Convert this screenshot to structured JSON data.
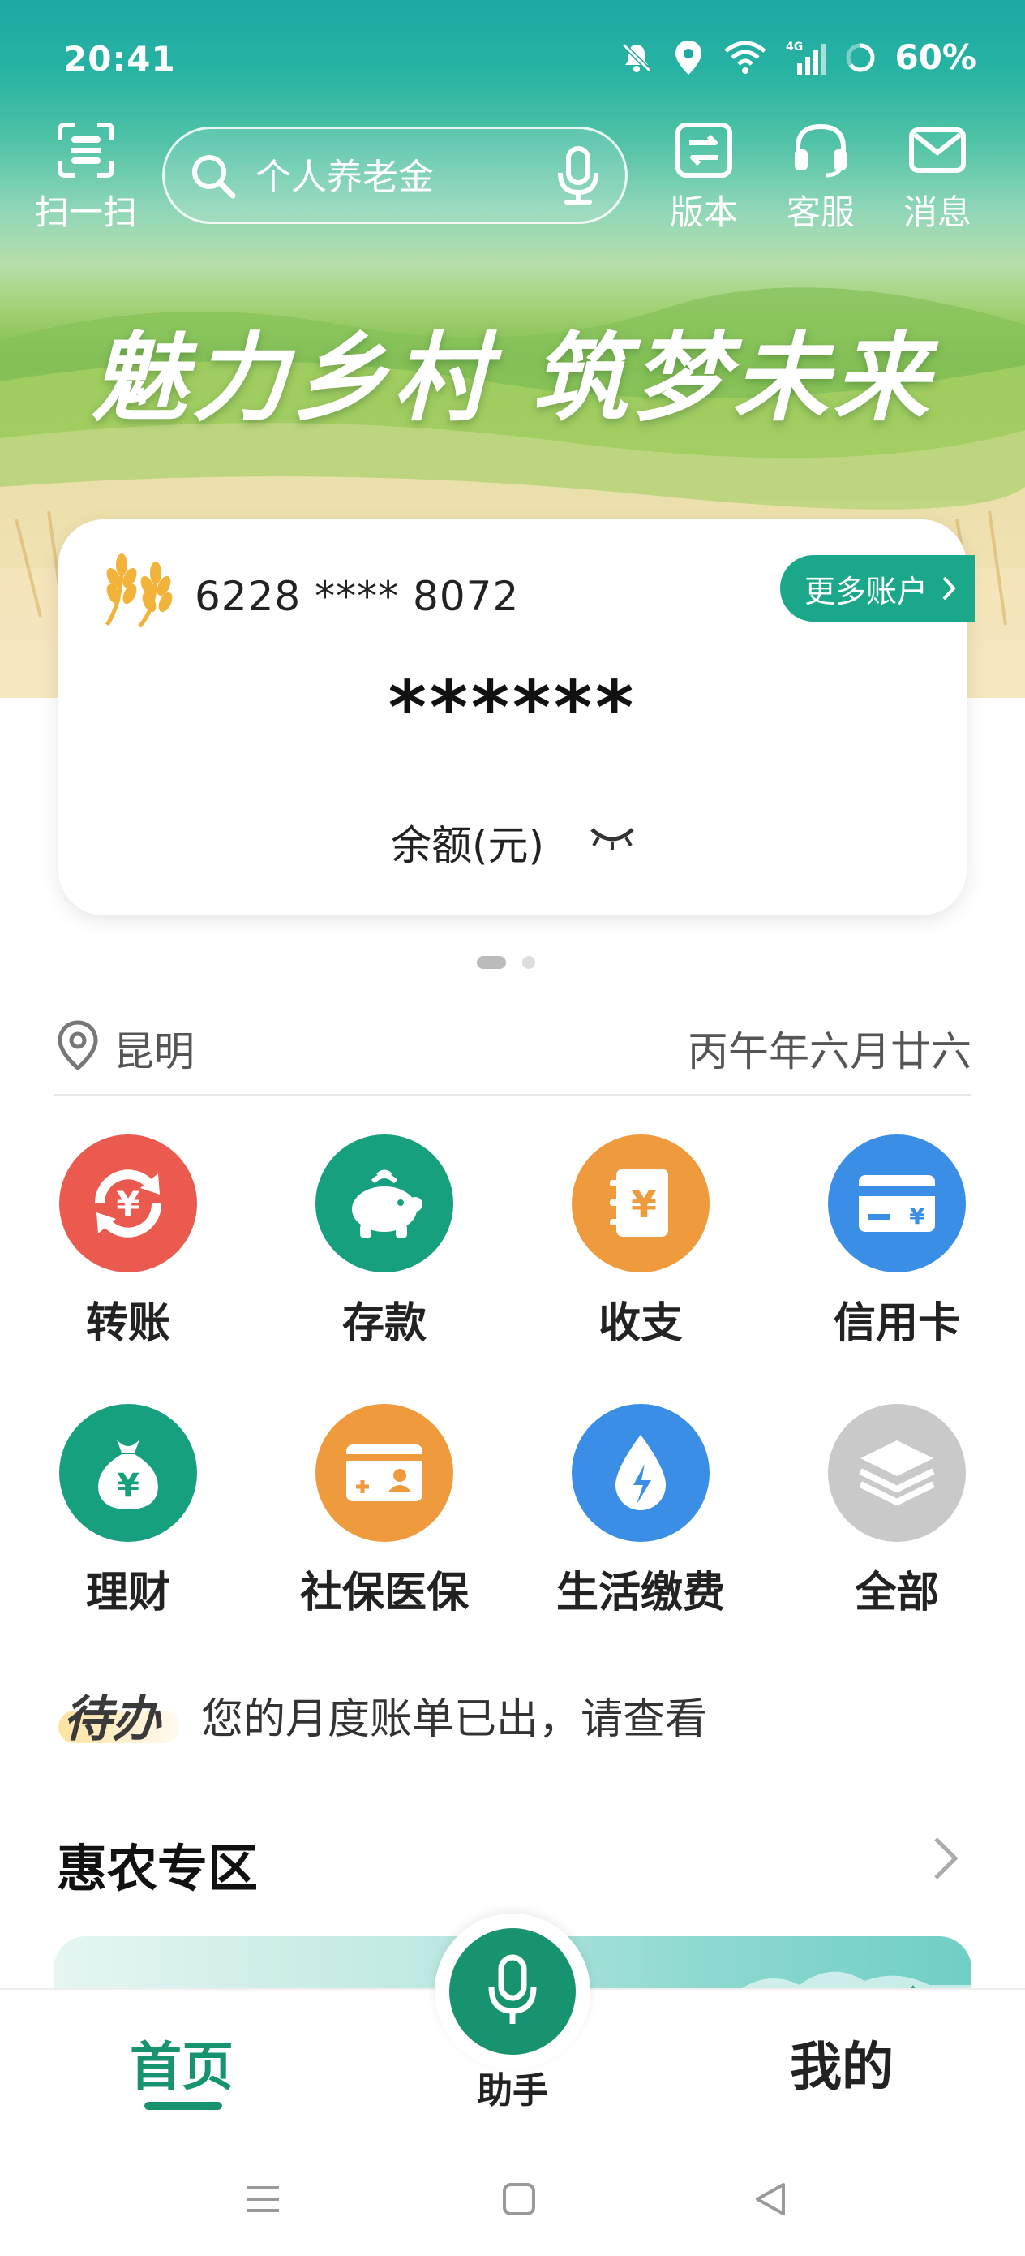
{
  "status_bar": {
    "time": "20:41",
    "network": "4G",
    "battery": "60%"
  },
  "topbar": {
    "scan_label": "扫一扫",
    "search_placeholder": "个人养老金",
    "version_label": "版本",
    "service_label": "客服",
    "messages_label": "消息"
  },
  "banner": {
    "slogan": "魅力乡村 筑梦未来"
  },
  "account": {
    "card_number": "6228 **** 8072",
    "more_accounts": "更多账户",
    "balance_masked": "******",
    "balance_label": "余额(元)"
  },
  "location": {
    "city": "昆明",
    "lunar_date": "丙午年六月廿六"
  },
  "functions": [
    {
      "label": "转账",
      "color": "#ea5a4f",
      "icon": "transfer-icon"
    },
    {
      "label": "存款",
      "color": "#17a07e",
      "icon": "piggy-bank-icon"
    },
    {
      "label": "收支",
      "color": "#ef9a3c",
      "icon": "ledger-icon"
    },
    {
      "label": "信用卡",
      "color": "#3a8ee6",
      "icon": "credit-card-icon"
    },
    {
      "label": "理财",
      "color": "#17a07e",
      "icon": "money-bag-icon"
    },
    {
      "label": "社保医保",
      "color": "#ef9a3c",
      "icon": "id-card-icon"
    },
    {
      "label": "生活缴费",
      "color": "#3a8ee6",
      "icon": "utility-drop-icon"
    },
    {
      "label": "全部",
      "color": "#c9c9c9",
      "icon": "layers-icon"
    }
  ],
  "todo": {
    "tag": "待办",
    "text": "您的月度账单已出，请查看"
  },
  "section": {
    "title": "惠农专区"
  },
  "bottom_nav": {
    "home": "首页",
    "assistant": "助手",
    "mine": "我的"
  },
  "colors": {
    "brand_green": "#17946f",
    "teal_top": "#1ea8a4"
  }
}
